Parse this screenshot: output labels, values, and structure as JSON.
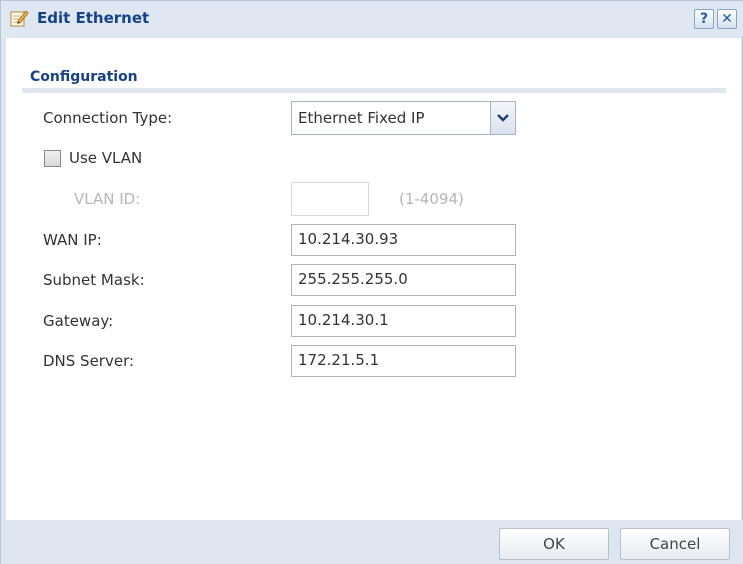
{
  "dialog": {
    "title": "Edit Ethernet",
    "help_glyph": "?",
    "close_glyph": "✕"
  },
  "section": {
    "title": "Configuration"
  },
  "connection_type": {
    "label": "Connection Type:",
    "value": "Ethernet Fixed IP"
  },
  "vlan": {
    "checkbox_label": "Use VLAN",
    "checked": false,
    "id_label": "VLAN ID:",
    "id_value": "",
    "range": "(1-4094)"
  },
  "fields": {
    "wan_ip": {
      "label": "WAN IP:",
      "value": "10.214.30.93"
    },
    "subnet_mask": {
      "label": "Subnet Mask:",
      "value": "255.255.255.0"
    },
    "gateway": {
      "label": "Gateway:",
      "value": "10.214.30.1"
    },
    "dns_server": {
      "label": "DNS Server:",
      "value": "172.21.5.1"
    }
  },
  "buttons": {
    "ok": "OK",
    "cancel": "Cancel"
  },
  "icons": {
    "title": "edit-pencil-icon",
    "help": "help-icon",
    "close": "close-icon",
    "dropdown": "chevron-down-icon"
  },
  "colors": {
    "title_text": "#15428b",
    "frame": "#dde5f0"
  }
}
